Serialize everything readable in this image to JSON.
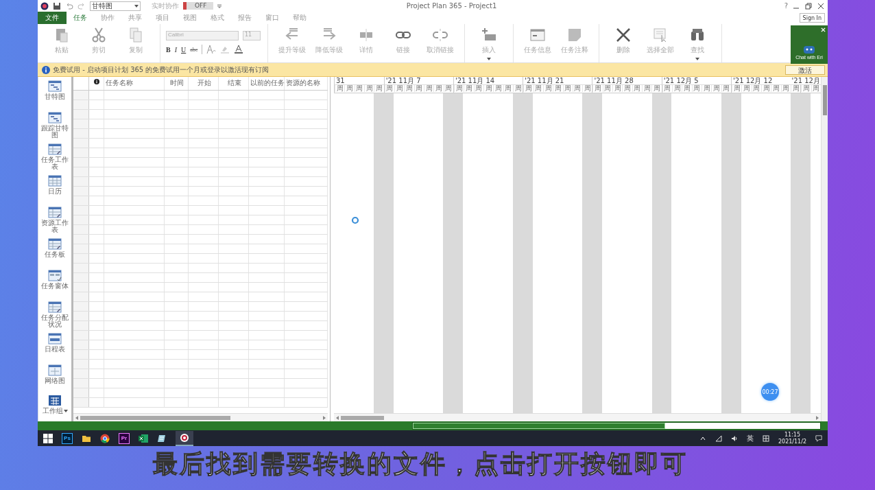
{
  "title_bar": {
    "view_dropdown": "甘特图",
    "collab_label": "实时协作",
    "collab_on": false,
    "collab_toggle": "OFF",
    "title": "Project Plan 365 - Project1",
    "help": "?"
  },
  "menu_tabs": [
    {
      "label": "文件",
      "kind": "file",
      "selected": false
    },
    {
      "label": "任务",
      "kind": "tab",
      "selected": true
    },
    {
      "label": "协作",
      "kind": "tab",
      "selected": false
    },
    {
      "label": "共享",
      "kind": "tab",
      "selected": false
    },
    {
      "label": "项目",
      "kind": "tab",
      "selected": false
    },
    {
      "label": "视图",
      "kind": "tab",
      "selected": false
    },
    {
      "label": "格式",
      "kind": "tab",
      "selected": false
    },
    {
      "label": "报告",
      "kind": "tab",
      "selected": false
    },
    {
      "label": "窗口",
      "kind": "tab",
      "selected": false
    },
    {
      "label": "帮助",
      "kind": "tab",
      "selected": false
    }
  ],
  "sign_in": "Sign In",
  "ribbon_groups": [
    {
      "kind": "buttons",
      "buttons": [
        {
          "label": "粘贴",
          "kind": "paste",
          "has_menu": false
        },
        {
          "label": "剪切",
          "kind": "cut",
          "has_menu": false
        },
        {
          "label": "复制",
          "kind": "copy",
          "has_menu": false
        }
      ]
    },
    {
      "kind": "font",
      "font_name": "Calibri",
      "font_size": "11",
      "styles": [
        {
          "text": "B",
          "kind": "bold"
        },
        {
          "text": "I",
          "kind": "italic"
        },
        {
          "text": "U",
          "kind": "underline"
        },
        {
          "text": "abc",
          "kind": "strike"
        }
      ]
    },
    {
      "kind": "buttons",
      "buttons": [
        {
          "label": "提升等级",
          "kind": "outdent",
          "has_menu": false
        },
        {
          "label": "降低等级",
          "kind": "indent",
          "has_menu": false
        },
        {
          "label": "详情",
          "kind": "details",
          "has_menu": false
        },
        {
          "label": "链接",
          "kind": "link",
          "has_menu": false
        },
        {
          "label": "取消链接",
          "kind": "unlink",
          "has_menu": false
        }
      ]
    },
    {
      "kind": "buttons",
      "buttons": [
        {
          "label": "插入",
          "kind": "insert",
          "has_menu": true
        }
      ]
    },
    {
      "kind": "buttons",
      "buttons": [
        {
          "label": "任务信息",
          "kind": "info",
          "has_menu": false
        },
        {
          "label": "任务注释",
          "kind": "note",
          "has_menu": false
        }
      ]
    },
    {
      "kind": "buttons",
      "buttons": [
        {
          "label": "删除",
          "kind": "delete",
          "has_menu": false
        },
        {
          "label": "选择全部",
          "kind": "select",
          "has_menu": false
        },
        {
          "label": "查找",
          "kind": "find",
          "has_menu": true
        }
      ]
    }
  ],
  "chat_widget": {
    "label": "Chat with Eri"
  },
  "info_bar": {
    "message": "免费试用 - 启动项目计划 365 的免费试用一个月或登录以激活现有订阅",
    "button": "激活"
  },
  "views": [
    {
      "label": "甘特图",
      "kind": "gantt"
    },
    {
      "label": "跟踪甘特图",
      "kind": "gantt"
    },
    {
      "label": "任务工作表",
      "kind": "sheet"
    },
    {
      "label": "日历",
      "kind": "calendar"
    },
    {
      "label": "资源工作表",
      "kind": "sheet"
    },
    {
      "label": "任务板",
      "kind": "sheet"
    },
    {
      "label": "任务窗体",
      "kind": "form"
    },
    {
      "label": "任务分配状况",
      "kind": "sheet"
    },
    {
      "label": "日程表",
      "kind": "timeline"
    },
    {
      "label": "网络图",
      "kind": "network"
    }
  ],
  "views_more": "工作组",
  "table": {
    "columns": [
      "任务名称",
      "时间",
      "开始",
      "结束",
      "以前的任务",
      "资源的名称"
    ]
  },
  "timescale": {
    "weeks": [
      {
        "label": "31",
        "days": [
          {
            "text": "周",
            "weekend": false
          },
          {
            "text": "周",
            "weekend": false
          },
          {
            "text": "周",
            "weekend": false
          },
          {
            "text": "周",
            "weekend": false
          },
          {
            "text": "周",
            "weekend": true
          }
        ]
      },
      {
        "label": "'21 11月 7",
        "days": [
          {
            "text": "周",
            "weekend": true
          },
          {
            "text": "周",
            "weekend": false
          },
          {
            "text": "周",
            "weekend": false
          },
          {
            "text": "周",
            "weekend": false
          },
          {
            "text": "周",
            "weekend": false
          },
          {
            "text": "周",
            "weekend": false
          },
          {
            "text": "周",
            "weekend": true
          }
        ]
      },
      {
        "label": "'21 11月 14",
        "days": [
          {
            "text": "周",
            "weekend": true
          },
          {
            "text": "周",
            "weekend": false
          },
          {
            "text": "周",
            "weekend": false
          },
          {
            "text": "周",
            "weekend": false
          },
          {
            "text": "周",
            "weekend": false
          },
          {
            "text": "周",
            "weekend": false
          },
          {
            "text": "周",
            "weekend": true
          }
        ]
      },
      {
        "label": "'21 11月 21",
        "days": [
          {
            "text": "周",
            "weekend": true
          },
          {
            "text": "周",
            "weekend": false
          },
          {
            "text": "周",
            "weekend": false
          },
          {
            "text": "周",
            "weekend": false
          },
          {
            "text": "周",
            "weekend": false
          },
          {
            "text": "周",
            "weekend": false
          },
          {
            "text": "周",
            "weekend": true
          }
        ]
      },
      {
        "label": "'21 11月 28",
        "days": [
          {
            "text": "周",
            "weekend": true
          },
          {
            "text": "周",
            "weekend": false
          },
          {
            "text": "周",
            "weekend": false
          },
          {
            "text": "周",
            "weekend": false
          },
          {
            "text": "周",
            "weekend": false
          },
          {
            "text": "周",
            "weekend": false
          },
          {
            "text": "周",
            "weekend": true
          }
        ]
      },
      {
        "label": "'21 12月 5",
        "days": [
          {
            "text": "周",
            "weekend": true
          },
          {
            "text": "周",
            "weekend": false
          },
          {
            "text": "周",
            "weekend": false
          },
          {
            "text": "周",
            "weekend": false
          },
          {
            "text": "周",
            "weekend": false
          },
          {
            "text": "周",
            "weekend": false
          },
          {
            "text": "周",
            "weekend": true
          }
        ]
      },
      {
        "label": "'21 12月 12",
        "days": [
          {
            "text": "周",
            "weekend": true
          },
          {
            "text": "周",
            "weekend": false
          },
          {
            "text": "周",
            "weekend": false
          },
          {
            "text": "周",
            "weekend": false
          },
          {
            "text": "周",
            "weekend": false
          },
          {
            "text": "周",
            "weekend": false
          },
          {
            "text": "周",
            "weekend": true
          }
        ]
      },
      {
        "label": "'21 12月",
        "days": [
          {
            "text": "周",
            "weekend": true
          },
          {
            "text": "周",
            "weekend": false
          }
        ]
      }
    ]
  },
  "status_bar": {
    "progress": {
      "level": 0.62
    }
  },
  "timer_badge": "00:27",
  "taskbar": {
    "apps": [
      {
        "kind": "start"
      },
      {
        "kind": "ps",
        "label": "Ps"
      },
      {
        "kind": "folder"
      },
      {
        "kind": "chrome"
      },
      {
        "kind": "pr",
        "label": "Pr"
      },
      {
        "kind": "excel"
      },
      {
        "kind": "notes"
      },
      {
        "kind": "project"
      }
    ],
    "language": "英",
    "time": "11:15",
    "date": "2021/11/2"
  },
  "subtitle": "最后找到需要转换的文件，点击打开按钮即可"
}
